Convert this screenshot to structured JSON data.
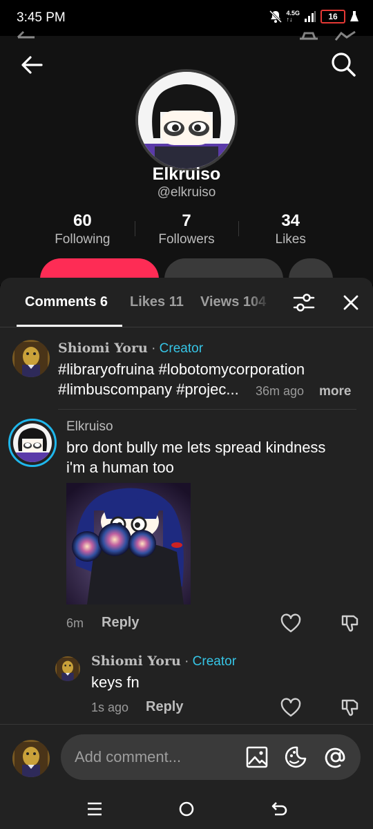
{
  "status_bar": {
    "time": "3:45 PM",
    "network": "4.5G",
    "network_sub": "↑↓",
    "battery": "16"
  },
  "profile": {
    "display_name": "Elkruiso",
    "username": "@elkruiso",
    "stats": [
      {
        "value": "60",
        "label": "Following"
      },
      {
        "value": "7",
        "label": "Followers"
      },
      {
        "value": "34",
        "label": "Likes"
      }
    ]
  },
  "tabs": [
    {
      "label": "Comments 6"
    },
    {
      "label": "Likes 11"
    },
    {
      "label": "Views 104"
    }
  ],
  "comments": [
    {
      "author": "Shiomi Yoru",
      "separator": "·",
      "badge": "Creator",
      "line1": "#libraryofruina #lobotomycorporation",
      "line2": "#limbuscompany #projec...",
      "time": "36m ago",
      "more": "more"
    },
    {
      "author": "Elkruiso",
      "line1": "bro dont bully me lets spread kindness",
      "line2": "i'm a human too",
      "time": "6m",
      "reply": "Reply"
    },
    {
      "author": "Shiomi Yoru",
      "separator": "·",
      "badge": "Creator",
      "text": "keys fn",
      "time": "1s ago",
      "reply": "Reply"
    }
  ],
  "composer": {
    "placeholder": "Add comment..."
  },
  "colors": {
    "accent": "#fe2c55",
    "creator": "#36c5e6",
    "sheet": "#222222"
  }
}
